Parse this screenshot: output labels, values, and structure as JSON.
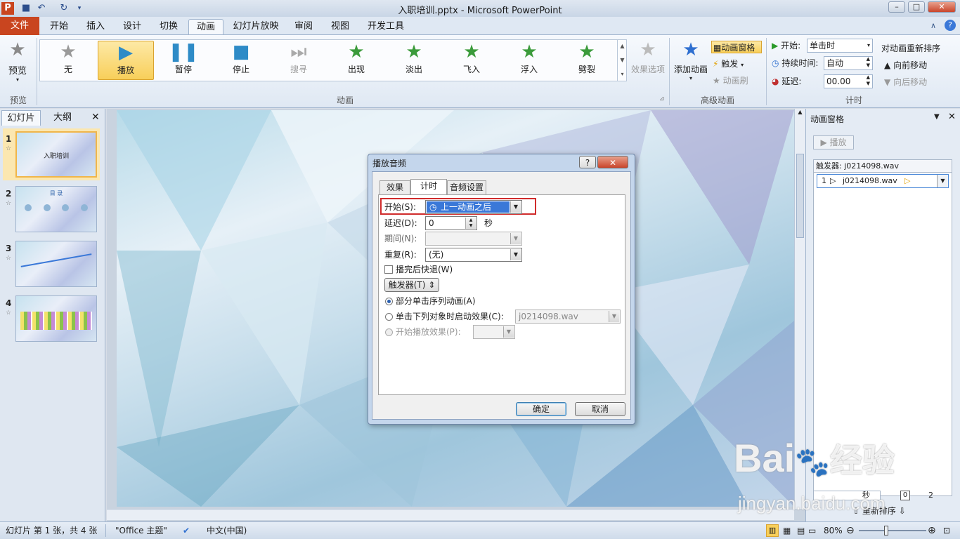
{
  "window": {
    "title": "入职培训.pptx - Microsoft PowerPoint"
  },
  "tabs": [
    "文件",
    "开始",
    "插入",
    "设计",
    "切换",
    "动画",
    "幻灯片放映",
    "审阅",
    "视图",
    "开发工具"
  ],
  "ribbon": {
    "preview": {
      "label": "预览",
      "group": "预览"
    },
    "animations": [
      "无",
      "播放",
      "暂停",
      "停止",
      "搜寻",
      "出现",
      "淡出",
      "飞入",
      "浮入",
      "劈裂"
    ],
    "effect_options": "效果选项",
    "anim_group": "动画",
    "add_animation": "添加动画",
    "anim_pane": "动画窗格",
    "trigger": "触发",
    "anim_painter": "动画刷",
    "adv_group": "高级动画",
    "start_label": "开始:",
    "start_value": "单击时",
    "duration_label": "持续时间:",
    "duration_value": "自动",
    "delay_label": "延迟:",
    "delay_value": "00.00",
    "reorder": "对动画重新排序",
    "move_earlier": "向前移动",
    "move_later": "向后移动",
    "timing_group": "计时"
  },
  "left_panel": {
    "tab_slides": "幻灯片",
    "tab_outline": "大纲",
    "slides": [
      "1",
      "2",
      "3",
      "4"
    ],
    "slide1_title": "入职培训",
    "slide2_title": "目 录"
  },
  "anim_pane": {
    "title": "动画窗格",
    "play": "播放",
    "trigger_header": "触发器: j0214098.wav",
    "item_num": "1",
    "item_name": "j0214098.wav",
    "seconds": "秒",
    "tick0": "0",
    "tick2": "2",
    "reorder": "重新排序"
  },
  "dialog": {
    "title": "播放音频",
    "tabs": [
      "效果",
      "计时",
      "音频设置"
    ],
    "start_label": "开始(S):",
    "start_value": "上一动画之后",
    "delay_label": "延迟(D):",
    "delay_value": "0",
    "delay_unit": "秒",
    "period_label": "期间(N):",
    "repeat_label": "重复(R):",
    "repeat_value": "(无)",
    "rewind_label": "播完后快退(W)",
    "trigger_button": "触发器(T)",
    "radio1": "部分单击序列动画(A)",
    "radio2": "单击下列对象时启动效果(C):",
    "radio2_value": "j0214098.wav",
    "radio3": "开始播放效果(P):",
    "ok": "确定",
    "cancel": "取消"
  },
  "status": {
    "slide_info": "幻灯片 第 1 张，共 4 张",
    "theme": "\"Office 主题\"",
    "language": "中文(中国)",
    "zoom": "80%"
  },
  "watermark": {
    "text1": "Bai",
    "text2": "经验",
    "url": "jingyan.baidu.com"
  },
  "colors": {
    "file_tab": "#c9451f",
    "selected": "#f8cf5a",
    "highlight_box": "#d02c2c",
    "select_blue": "#3a78d8"
  }
}
